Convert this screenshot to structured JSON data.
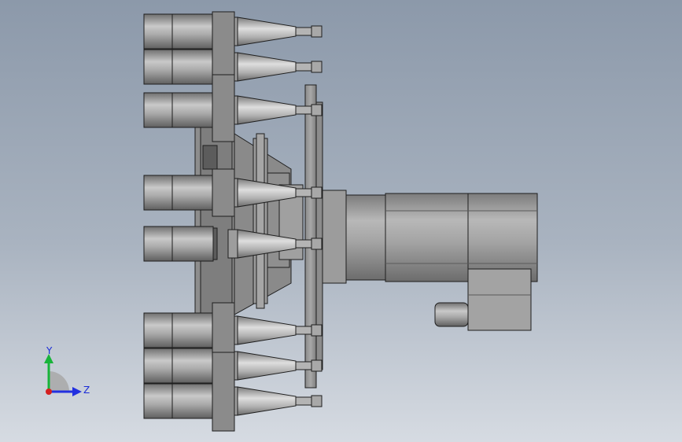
{
  "view": {
    "model": "tool-changer-assembly",
    "colors": {
      "background_top": "#8c99aa",
      "background_bottom": "#d6dbe2",
      "part_gray": "#9a9a9a",
      "edge": "#1e1e1e"
    }
  },
  "triad": {
    "y_label": "Y",
    "z_label": "Z",
    "y_color": "#18b43a",
    "z_color": "#2230e0",
    "x_color": "#d42020"
  }
}
